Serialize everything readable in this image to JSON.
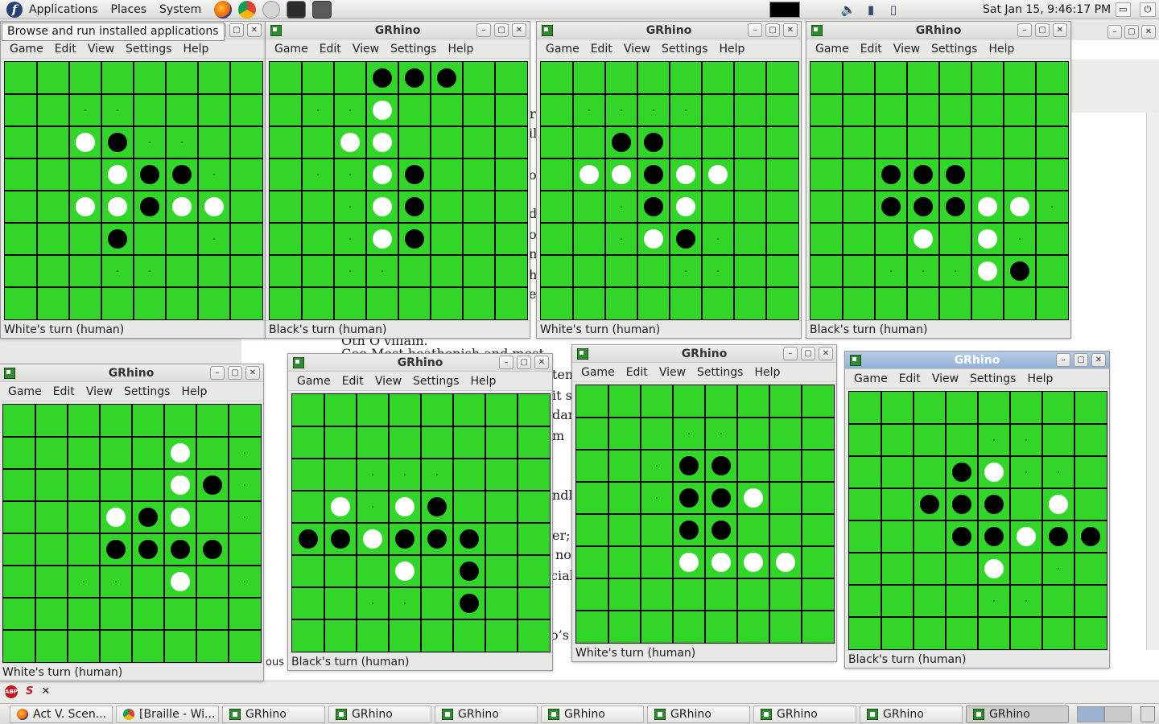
{
  "top_panel": {
    "menus": [
      "Applications",
      "Places",
      "System"
    ],
    "clock": "Sat Jan 15,  9:46:17 PM",
    "tooltip": "Browse and run installed applications",
    "launchers": [
      "firefox-icon",
      "chrome-icon",
      "mail-icon",
      "terminal-icon",
      "calculator-icon"
    ]
  },
  "background_doc": {
    "text_fragments": [
      "r",
      "il",
      "o",
      "d",
      "ot",
      "n",
      "h",
      "er",
      "Oth  O villain.",
      "Geo      Most heathenish and most",
      "ten",
      "it s",
      "dar",
      "m",
      "ndl",
      "er;",
      "no",
      "cial",
      "o’s",
      "ous"
    ]
  },
  "taskbar": {
    "items": [
      {
        "label": "Act V. Scen...",
        "icon": "firefox"
      },
      {
        "label": "[Braille - Wi...",
        "icon": "chrome"
      },
      {
        "label": "GRhino",
        "icon": "grhino"
      },
      {
        "label": "GRhino",
        "icon": "grhino"
      },
      {
        "label": "GRhino",
        "icon": "grhino"
      },
      {
        "label": "GRhino",
        "icon": "grhino"
      },
      {
        "label": "GRhino",
        "icon": "grhino"
      },
      {
        "label": "GRhino",
        "icon": "grhino"
      },
      {
        "label": "GRhino",
        "icon": "grhino"
      },
      {
        "label": "GRhino",
        "icon": "grhino",
        "active": true
      }
    ]
  },
  "app": {
    "title": "GRhino",
    "menus": [
      "Game",
      "Edit",
      "View",
      "Settings",
      "Help"
    ],
    "colors": {
      "board": "#31d628",
      "grid": "#000000",
      "black_disc": "#000000",
      "white_disc": "#ffffff",
      "hint": "#1a6e12"
    }
  },
  "windows": [
    {
      "title": "",
      "status": "White's turn (human)",
      "board": [
        "........",
        "..''....",
        "..WB''..",
        "...WBB'.",
        "..WWBWW.",
        "...B..'.",
        "...''...",
        "........"
      ]
    },
    {
      "title": "GRhino",
      "status": "Black's turn (human)",
      "board": [
        "...BBB..",
        ".''W....",
        "..WW....",
        ".''WB...",
        "..'WB...",
        "..'WB...",
        "..''....",
        "........"
      ]
    },
    {
      "title": "GRhino",
      "status": "White's turn (human)",
      "board": [
        "........",
        ".''''...",
        "..BB....",
        ".WWBWW..",
        "..'BW...",
        "..'WB'..",
        "....''..",
        "........"
      ]
    },
    {
      "title": "GRhino",
      "status": "Black's turn (human)",
      "board": [
        "........",
        "........",
        "........",
        "..BBB...",
        "..BBBWW'",
        "...W.W'.",
        "..'''WB.",
        "........"
      ]
    },
    {
      "title": "GRhino",
      "status": "White's turn (human)",
      "board": [
        "........",
        ".....W.'",
        ".....WB'",
        "...WBW.'",
        "...BBBB.",
        "..''.W.'",
        "........",
        "........"
      ]
    },
    {
      "title": "GRhino",
      "status": "Black's turn (human)",
      "board": [
        "........",
        "........",
        "..'''...",
        ".W'WB...",
        "BBWBBB..",
        "...W.B..",
        "..''.B..",
        "........"
      ]
    },
    {
      "title": "GRhino",
      "status": "White's turn (human)",
      "board": [
        "........",
        "...''...",
        "..'BB...",
        "..'BBW..",
        "...BB...",
        "...WWWW.",
        "........",
        "........"
      ]
    },
    {
      "title": "GRhino",
      "status": "Black's turn (human)",
      "board": [
        "........",
        "....''..",
        "...BW''.",
        "..BBB.W.",
        "...BBWBB",
        "....W.'.",
        "....''..",
        "........"
      ]
    }
  ]
}
